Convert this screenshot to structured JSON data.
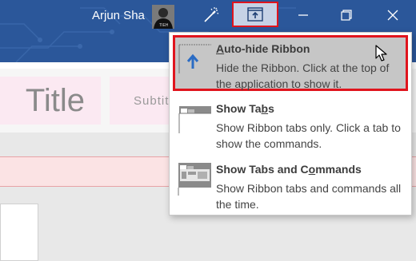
{
  "titlebar": {
    "user_name": "Arjun Sha",
    "avatar_text": "TIEH"
  },
  "styles": {
    "title_label": "Title",
    "subtitle_label": "Subtitl"
  },
  "menu": {
    "items": [
      {
        "title_prefix": "",
        "title_access": "A",
        "title_rest": "uto-hide Ribbon",
        "description": "Hide the Ribbon. Click at the top of the application to show it."
      },
      {
        "title_prefix": "Show Ta",
        "title_access": "b",
        "title_rest": "s",
        "description": "Show Ribbon tabs only. Click a tab to show the commands."
      },
      {
        "title_prefix": "Show Tabs and C",
        "title_access": "o",
        "title_rest": "mmands",
        "description": "Show Ribbon tabs and commands all the time."
      }
    ]
  },
  "colors": {
    "titlebar": "#2b579a",
    "highlight_border": "#e0141d",
    "selected_bg": "#c6c6c6"
  }
}
